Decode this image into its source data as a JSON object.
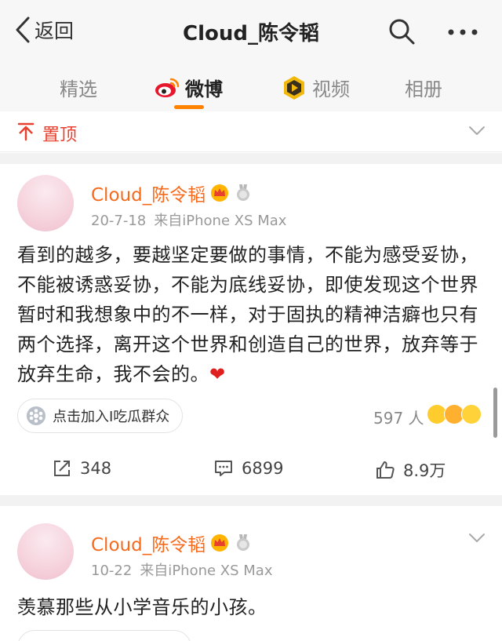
{
  "nav": {
    "back_label": "返回",
    "title": "Cloud_陈令韬"
  },
  "tabs": [
    {
      "label": "精选"
    },
    {
      "label": "微博"
    },
    {
      "label": "视频"
    },
    {
      "label": "相册"
    }
  ],
  "pinned": {
    "label": "置顶"
  },
  "posts": [
    {
      "author": "Cloud_陈令韬",
      "date": "20-7-18",
      "source": "来自iPhone XS Max",
      "text": "看到的越多，要越坚定要做的事情，不能为感受妥协，不能被诱惑妥协，不能为底线妥协，即使发现这个世界暂时和我想象中的不一样，对于固执的精神洁癖也只有两个选择，离开这个世界和创造自己的世界，放弃等于放弃生命，我不会的。",
      "heart": "❤",
      "group_chip": "点击加入I吃瓜群众",
      "reactions_count": "597 人",
      "reposts": "348",
      "comments": "6899",
      "likes": "8.9万"
    },
    {
      "author": "Cloud_陈令韬",
      "date": "10-22",
      "source": "来自iPhone XS Max",
      "text": "羡慕那些从小学音乐的小孩。"
    }
  ],
  "colors": {
    "accent_orange": "#ff8200",
    "author_orange": "#f56a1c",
    "pinned_red": "#e8402e",
    "heart_red": "#e02020"
  },
  "icons": [
    "chevron-left-icon",
    "search-icon",
    "more-icon",
    "weibo-logo-icon",
    "video-icon",
    "pin-top-icon",
    "chevron-down-icon",
    "vip-crown-icon",
    "medal-icon",
    "group-icon",
    "repost-icon",
    "comment-icon",
    "like-icon"
  ]
}
